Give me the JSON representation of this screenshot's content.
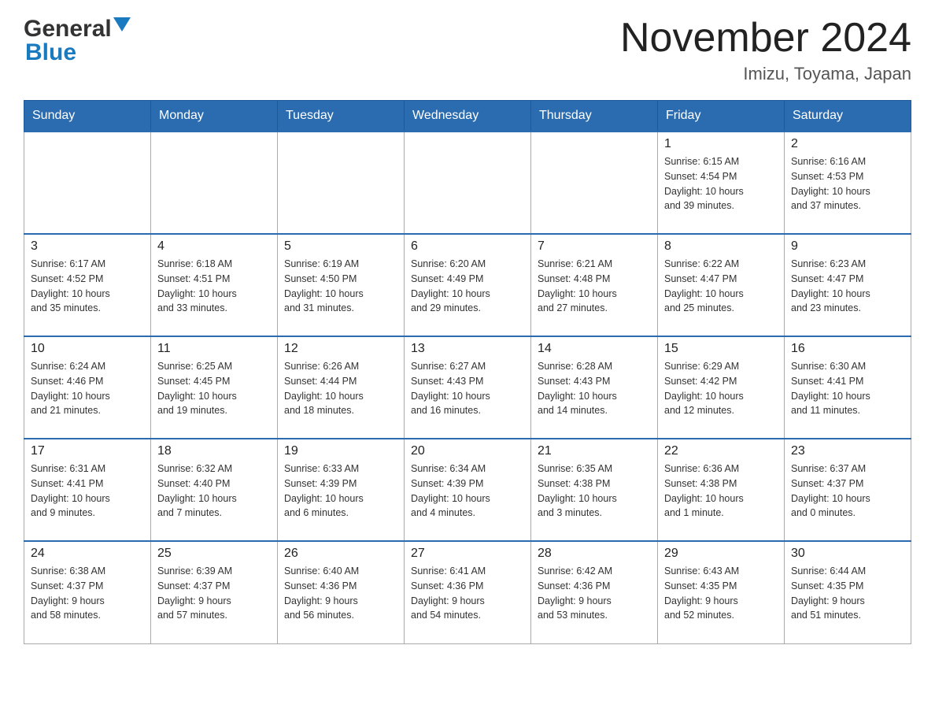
{
  "header": {
    "month_title": "November 2024",
    "location": "Imizu, Toyama, Japan",
    "logo_general": "General",
    "logo_blue": "Blue"
  },
  "weekdays": [
    "Sunday",
    "Monday",
    "Tuesday",
    "Wednesday",
    "Thursday",
    "Friday",
    "Saturday"
  ],
  "weeks": [
    [
      {
        "day": "",
        "info": ""
      },
      {
        "day": "",
        "info": ""
      },
      {
        "day": "",
        "info": ""
      },
      {
        "day": "",
        "info": ""
      },
      {
        "day": "",
        "info": ""
      },
      {
        "day": "1",
        "info": "Sunrise: 6:15 AM\nSunset: 4:54 PM\nDaylight: 10 hours\nand 39 minutes."
      },
      {
        "day": "2",
        "info": "Sunrise: 6:16 AM\nSunset: 4:53 PM\nDaylight: 10 hours\nand 37 minutes."
      }
    ],
    [
      {
        "day": "3",
        "info": "Sunrise: 6:17 AM\nSunset: 4:52 PM\nDaylight: 10 hours\nand 35 minutes."
      },
      {
        "day": "4",
        "info": "Sunrise: 6:18 AM\nSunset: 4:51 PM\nDaylight: 10 hours\nand 33 minutes."
      },
      {
        "day": "5",
        "info": "Sunrise: 6:19 AM\nSunset: 4:50 PM\nDaylight: 10 hours\nand 31 minutes."
      },
      {
        "day": "6",
        "info": "Sunrise: 6:20 AM\nSunset: 4:49 PM\nDaylight: 10 hours\nand 29 minutes."
      },
      {
        "day": "7",
        "info": "Sunrise: 6:21 AM\nSunset: 4:48 PM\nDaylight: 10 hours\nand 27 minutes."
      },
      {
        "day": "8",
        "info": "Sunrise: 6:22 AM\nSunset: 4:47 PM\nDaylight: 10 hours\nand 25 minutes."
      },
      {
        "day": "9",
        "info": "Sunrise: 6:23 AM\nSunset: 4:47 PM\nDaylight: 10 hours\nand 23 minutes."
      }
    ],
    [
      {
        "day": "10",
        "info": "Sunrise: 6:24 AM\nSunset: 4:46 PM\nDaylight: 10 hours\nand 21 minutes."
      },
      {
        "day": "11",
        "info": "Sunrise: 6:25 AM\nSunset: 4:45 PM\nDaylight: 10 hours\nand 19 minutes."
      },
      {
        "day": "12",
        "info": "Sunrise: 6:26 AM\nSunset: 4:44 PM\nDaylight: 10 hours\nand 18 minutes."
      },
      {
        "day": "13",
        "info": "Sunrise: 6:27 AM\nSunset: 4:43 PM\nDaylight: 10 hours\nand 16 minutes."
      },
      {
        "day": "14",
        "info": "Sunrise: 6:28 AM\nSunset: 4:43 PM\nDaylight: 10 hours\nand 14 minutes."
      },
      {
        "day": "15",
        "info": "Sunrise: 6:29 AM\nSunset: 4:42 PM\nDaylight: 10 hours\nand 12 minutes."
      },
      {
        "day": "16",
        "info": "Sunrise: 6:30 AM\nSunset: 4:41 PM\nDaylight: 10 hours\nand 11 minutes."
      }
    ],
    [
      {
        "day": "17",
        "info": "Sunrise: 6:31 AM\nSunset: 4:41 PM\nDaylight: 10 hours\nand 9 minutes."
      },
      {
        "day": "18",
        "info": "Sunrise: 6:32 AM\nSunset: 4:40 PM\nDaylight: 10 hours\nand 7 minutes."
      },
      {
        "day": "19",
        "info": "Sunrise: 6:33 AM\nSunset: 4:39 PM\nDaylight: 10 hours\nand 6 minutes."
      },
      {
        "day": "20",
        "info": "Sunrise: 6:34 AM\nSunset: 4:39 PM\nDaylight: 10 hours\nand 4 minutes."
      },
      {
        "day": "21",
        "info": "Sunrise: 6:35 AM\nSunset: 4:38 PM\nDaylight: 10 hours\nand 3 minutes."
      },
      {
        "day": "22",
        "info": "Sunrise: 6:36 AM\nSunset: 4:38 PM\nDaylight: 10 hours\nand 1 minute."
      },
      {
        "day": "23",
        "info": "Sunrise: 6:37 AM\nSunset: 4:37 PM\nDaylight: 10 hours\nand 0 minutes."
      }
    ],
    [
      {
        "day": "24",
        "info": "Sunrise: 6:38 AM\nSunset: 4:37 PM\nDaylight: 9 hours\nand 58 minutes."
      },
      {
        "day": "25",
        "info": "Sunrise: 6:39 AM\nSunset: 4:37 PM\nDaylight: 9 hours\nand 57 minutes."
      },
      {
        "day": "26",
        "info": "Sunrise: 6:40 AM\nSunset: 4:36 PM\nDaylight: 9 hours\nand 56 minutes."
      },
      {
        "day": "27",
        "info": "Sunrise: 6:41 AM\nSunset: 4:36 PM\nDaylight: 9 hours\nand 54 minutes."
      },
      {
        "day": "28",
        "info": "Sunrise: 6:42 AM\nSunset: 4:36 PM\nDaylight: 9 hours\nand 53 minutes."
      },
      {
        "day": "29",
        "info": "Sunrise: 6:43 AM\nSunset: 4:35 PM\nDaylight: 9 hours\nand 52 minutes."
      },
      {
        "day": "30",
        "info": "Sunrise: 6:44 AM\nSunset: 4:35 PM\nDaylight: 9 hours\nand 51 minutes."
      }
    ]
  ]
}
